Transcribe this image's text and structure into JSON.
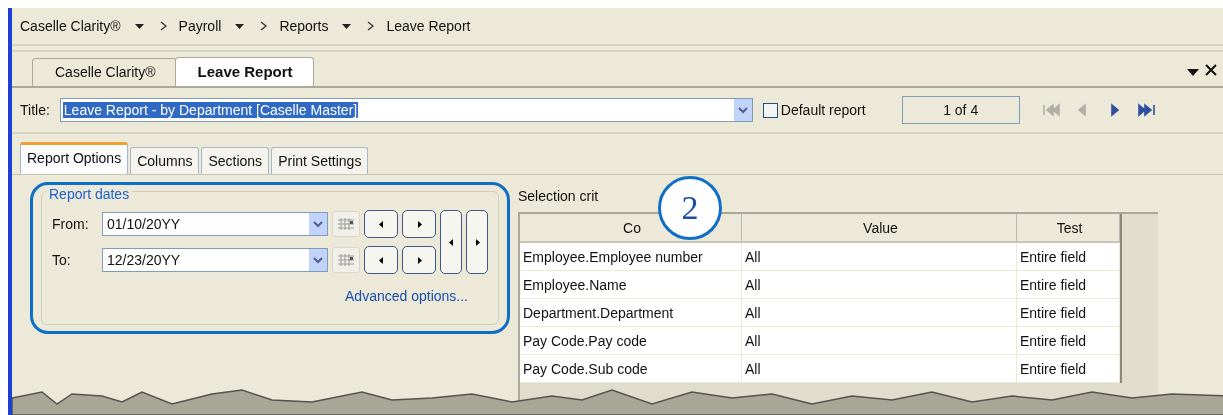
{
  "breadcrumb": [
    {
      "label": "Caselle Clarity®",
      "has_menu": true
    },
    {
      "label": "Payroll",
      "has_menu": true
    },
    {
      "label": "Reports",
      "has_menu": true
    },
    {
      "label": "Leave Report",
      "has_menu": false
    }
  ],
  "doc_tabs": [
    {
      "label": "Caselle Clarity®",
      "selected": false
    },
    {
      "label": "Leave Report",
      "selected": true
    }
  ],
  "title_field": {
    "label": "Title:",
    "value": "Leave Report - by Department [Caselle Master]"
  },
  "default_report": {
    "label": "Default report",
    "checked": false
  },
  "page_indicator": "1 of 4",
  "nav_buttons": [
    {
      "kind": "first",
      "disabled": true
    },
    {
      "kind": "prev",
      "disabled": true
    },
    {
      "kind": "next",
      "disabled": false
    },
    {
      "kind": "last",
      "disabled": false
    }
  ],
  "option_tabs": [
    {
      "label": "Report Options",
      "selected": true
    },
    {
      "label": "Columns",
      "selected": false
    },
    {
      "label": "Sections",
      "selected": false
    },
    {
      "label": "Print Settings",
      "selected": false
    }
  ],
  "report_dates": {
    "legend": "Report dates",
    "rows": [
      {
        "label": "From:",
        "value": "01/10/20YY"
      },
      {
        "label": "To:",
        "value": "12/23/20YY"
      }
    ],
    "link": "Advanced options..."
  },
  "selection": {
    "label": "Selection crit",
    "columns": [
      "Co",
      "Value",
      "Test"
    ],
    "rows": [
      [
        "Employee.Employee number",
        "All",
        "Entire field"
      ],
      [
        "Employee.Name",
        "All",
        "Entire field"
      ],
      [
        "Department.Department",
        "All",
        "Entire field"
      ],
      [
        "Pay Code.Pay code",
        "All",
        "Entire field"
      ],
      [
        "Pay Code.Sub code",
        "All",
        "Entire field"
      ]
    ]
  },
  "callout": "2"
}
